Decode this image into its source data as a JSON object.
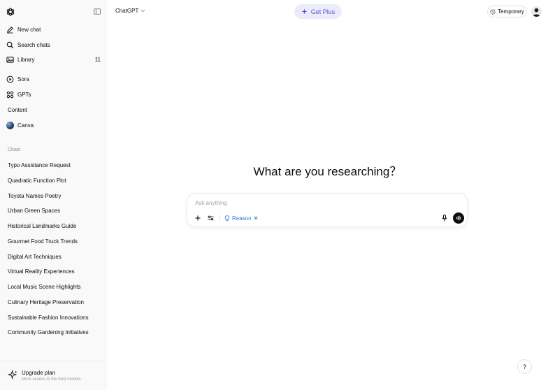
{
  "sidebar": {
    "nav": [
      {
        "label": "New chat",
        "icon": "edit-icon"
      },
      {
        "label": "Search chats",
        "icon": "search-icon"
      },
      {
        "label": "Library",
        "icon": "library-icon",
        "count": "11"
      },
      {
        "label": "Sora",
        "icon": "play-circle-icon"
      },
      {
        "label": "GPTs",
        "icon": "grid-icon"
      },
      {
        "label": "Content",
        "icon": ""
      },
      {
        "label": "Canva",
        "icon": "canva-icon"
      }
    ],
    "chats_label": "Chats",
    "chats": [
      "Typo Assistance Request",
      "Quadratic Function Plot",
      "Toyota Names Poetry",
      "Urban Green Spaces",
      "Historical Landmarks Guide",
      "Gourmet Food Truck Trends",
      "Digital Art Techniques",
      "Virtual Reality Experiences",
      "Local Music Scene Highlights",
      "Culinary Heritage Preservation",
      "Sustainable Fashion Innovations",
      "Community Gardening Initiatives"
    ],
    "upgrade": {
      "title": "Upgrade plan",
      "subtitle": "More access to the best models"
    }
  },
  "header": {
    "model": "ChatGPT",
    "get_plus": "Get Plus",
    "temporary": "Temporary"
  },
  "main": {
    "heading": "What are you researching？",
    "composer": {
      "placeholder": "Ask anything",
      "chip": "Reason"
    },
    "help": "?"
  },
  "colors": {
    "sidebar_bg": "#f9f9f9",
    "accent_purple": "#5b51d8",
    "get_plus_bg": "#ecebfb",
    "reason_blue": "#2f7bd8"
  }
}
